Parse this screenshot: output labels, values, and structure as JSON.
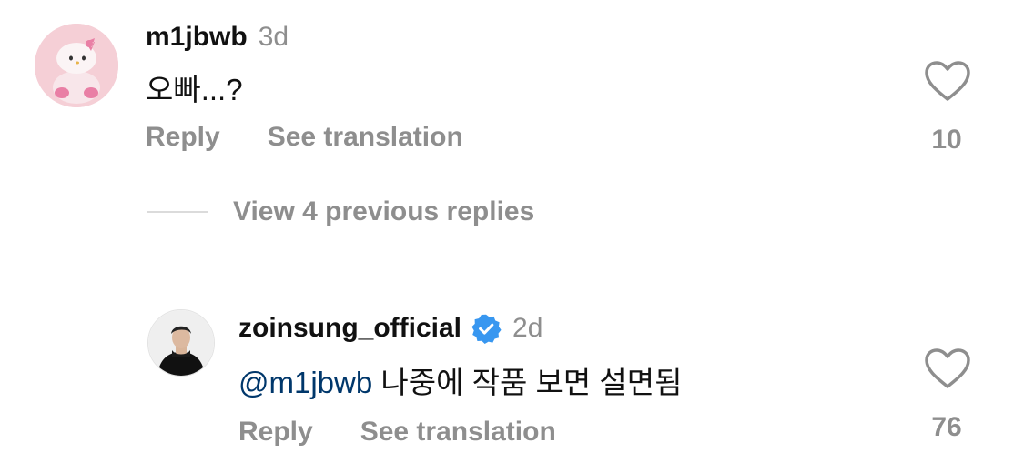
{
  "comments": [
    {
      "username": "m1jbwb",
      "time": "3d",
      "text": "오빠...?",
      "reply_label": "Reply",
      "translate_label": "See translation",
      "likes": "10",
      "avatar_icon": "hello-kitty-avatar",
      "verified": false
    },
    {
      "username": "zoinsung_official",
      "time": "2d",
      "mention": "@m1jbwb",
      "text": "나중에 작품 보면 설면됨",
      "reply_label": "Reply",
      "translate_label": "See translation",
      "likes": "76",
      "avatar_icon": "profile-photo-avatar",
      "verified": true,
      "verified_icon": "verified-badge-icon"
    }
  ],
  "view_replies": {
    "label": "View 4 previous replies"
  },
  "colors": {
    "text": "#111111",
    "muted": "#8e8e8e",
    "mention": "#00376b",
    "verified": "#3897f0",
    "divider": "#dbdbdb"
  }
}
